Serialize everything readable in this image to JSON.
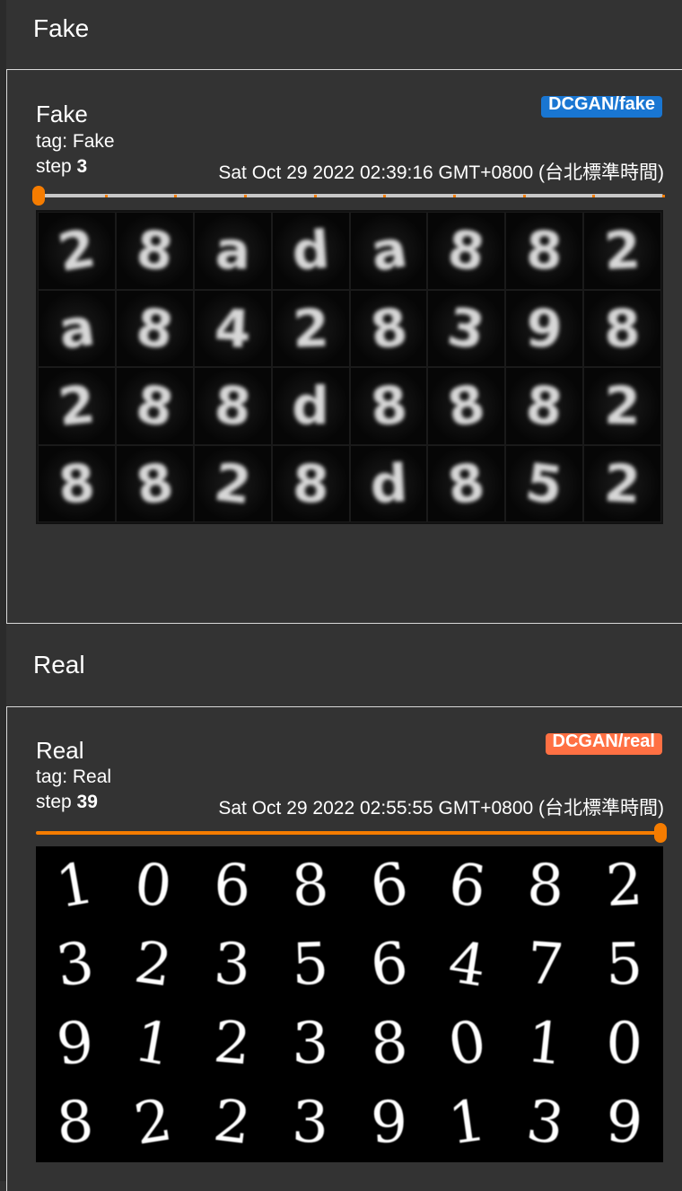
{
  "sections": [
    {
      "header": "Fake",
      "card": {
        "title": "Fake",
        "tag_label": "tag: ",
        "tag_value": "Fake",
        "step_label": "step ",
        "step_value": "3",
        "timestamp": "Sat Oct 29 2022 02:39:16 GMT+0800 (台北標準時間)",
        "run_badge": "DCGAN/fake",
        "run_color": "#1976d2",
        "slider_position": 0.0,
        "slider_ticks": 10,
        "slider_color": "#f57c00",
        "image_grid": {
          "rows": 4,
          "cols": 8,
          "digits": [
            "2",
            "8",
            "a",
            "d",
            "a",
            "8",
            "8",
            "2",
            "a",
            "8",
            "4",
            "2",
            "8",
            "3",
            "9",
            "8",
            "2",
            "8",
            "8",
            "d",
            "8",
            "8",
            "8",
            "2",
            "8",
            "8",
            "2",
            "8",
            "d",
            "8",
            "5",
            "2"
          ]
        }
      }
    },
    {
      "header": "Real",
      "card": {
        "title": "Real",
        "tag_label": "tag: ",
        "tag_value": "Real",
        "step_label": "step ",
        "step_value": "39",
        "timestamp": "Sat Oct 29 2022 02:55:55 GMT+0800 (台北標準時間)",
        "run_badge": "DCGAN/real",
        "run_color": "#ff7043",
        "slider_position": 1.0,
        "slider_ticks": 0,
        "slider_color": "#f57c00",
        "image_grid": {
          "rows": 4,
          "cols": 8,
          "digits": [
            "1",
            "0",
            "6",
            "8",
            "6",
            "6",
            "8",
            "2",
            "3",
            "2",
            "3",
            "5",
            "6",
            "4",
            "7",
            "5",
            "9",
            "1",
            "2",
            "3",
            "8",
            "0",
            "1",
            "0",
            "8",
            "2",
            "2",
            "3",
            "9",
            "1",
            "3",
            "9"
          ]
        }
      }
    }
  ]
}
